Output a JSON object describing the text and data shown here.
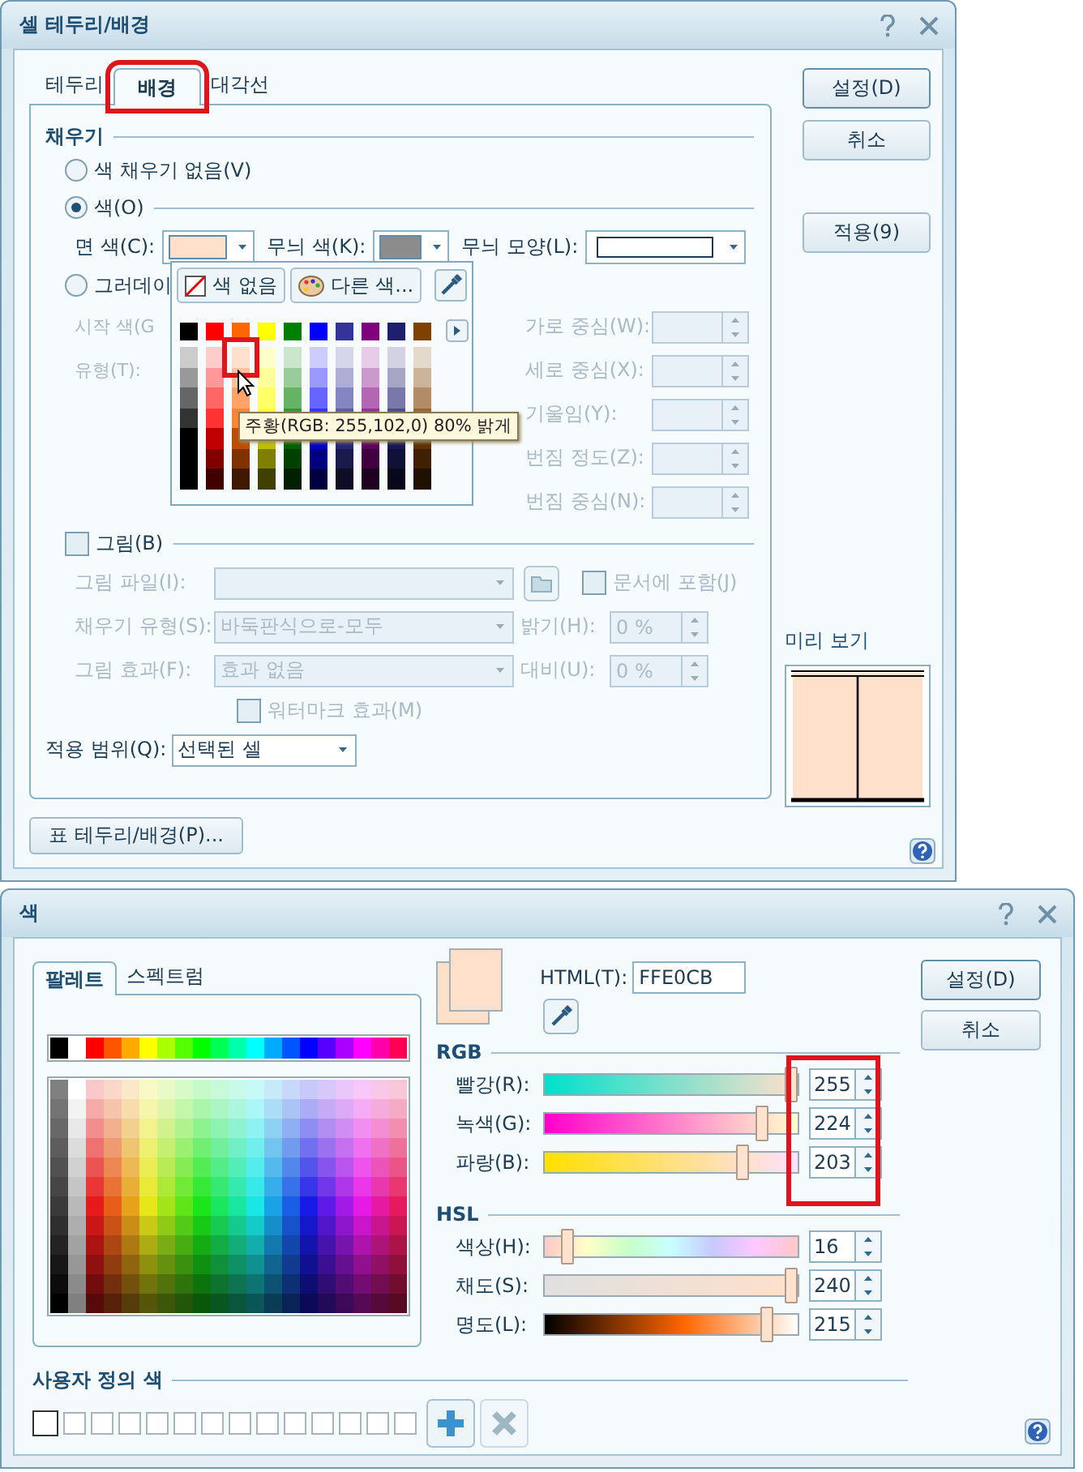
{
  "border_dialog": {
    "title": "셀 테두리/배경",
    "tabs": [
      {
        "label": "테두리",
        "selected": false,
        "highlighted": false
      },
      {
        "label": "배경",
        "selected": true,
        "highlighted": true
      },
      {
        "label": "대각선",
        "selected": false,
        "highlighted": false
      }
    ],
    "fill": {
      "heading": "채우기",
      "options": [
        {
          "label": "색 채우기 없음(V)",
          "selected": false
        },
        {
          "label": "색(O)",
          "selected": true
        }
      ],
      "swatches": [
        {
          "label": "면 색(C):",
          "color": "#ffe0cb"
        },
        {
          "label": "무늬 색(K):",
          "color": "#8c8c8c"
        }
      ],
      "pattern_shape_label": "무늬 모양(L):",
      "gradient": {
        "label": "그러데이",
        "selected": false,
        "start_color_label": "시작 색(G",
        "type_label": "유형(T):",
        "fields": [
          {
            "label": "가로 중심(W):"
          },
          {
            "label": "세로 중심(X):"
          },
          {
            "label": "기울임(Y):"
          },
          {
            "label": "번짐 정도(Z):"
          },
          {
            "label": "번짐 중심(N):"
          }
        ]
      }
    },
    "picture": {
      "label": "그림(B)",
      "checked": false,
      "file_label": "그림 파일(I):",
      "embed_label": "문서에 포함(J)",
      "embed_checked": false,
      "fill_type_label": "채우기 유형(S):",
      "fill_type": "바둑판식으로-모두",
      "brightness_label": "밝기(H):",
      "brightness": "0 %",
      "effect_label": "그림 효과(F):",
      "effect": "효과 없음",
      "contrast_label": "대비(U):",
      "contrast": "0 %",
      "watermark_label": "워터마크 효과(M)",
      "watermark_checked": false
    },
    "scope": {
      "label": "적용 범위(Q):",
      "value": "선택된 셀"
    },
    "table_button": "표 테두리/배경(P)...",
    "buttons": [
      {
        "label": "설정(D)",
        "default": true
      },
      {
        "label": "취소",
        "default": false
      },
      {
        "label": "적용(9)",
        "default": false
      }
    ],
    "preview": {
      "label": "미리 보기",
      "color": "#ffe0cb"
    },
    "color_popup": {
      "no_color": "색 없음",
      "more_colors": "다른 색...",
      "tooltip": "주황(RGB: 255,102,0) 80% 밝게",
      "colors": [
        {
          "color": "#000000",
          "tint_hovered": false
        },
        {
          "color": "#ff0000",
          "tint_hovered": false
        },
        {
          "color": "#ff6600",
          "tint_hovered": true
        },
        {
          "color": "#ffff00",
          "tint_hovered": false
        },
        {
          "color": "#008000",
          "tint_hovered": false
        },
        {
          "color": "#0000ff",
          "tint_hovered": false
        },
        {
          "color": "#333399",
          "tint_hovered": false
        },
        {
          "color": "#800080",
          "tint_hovered": false
        },
        {
          "color": "#1f1f70",
          "tint_hovered": false
        },
        {
          "color": "#7f4000",
          "tint_hovered": false
        }
      ]
    }
  },
  "color_dialog": {
    "title": "색",
    "tabs": [
      {
        "label": "팔레트",
        "selected": true
      },
      {
        "label": "스펙트럼",
        "selected": false
      }
    ],
    "html_label": "HTML(T):",
    "html_value": "FFE0CB",
    "rgb_heading": "RGB",
    "values_highlighted": true,
    "rgb": [
      {
        "label": "빨강(R):",
        "kind": "red",
        "level": 1,
        "value": "255"
      },
      {
        "label": "녹색(G):",
        "kind": "green",
        "level": 0.878,
        "value": "224"
      },
      {
        "label": "파랑(B):",
        "kind": "blue",
        "level": 0.796,
        "value": "203"
      }
    ],
    "hsl_heading": "HSL",
    "hsl": [
      {
        "label": "색상(H):",
        "kind": "hue",
        "level": 0.067,
        "value": "16"
      },
      {
        "label": "채도(S):",
        "kind": "saturation",
        "level": 1,
        "value": "240"
      },
      {
        "label": "명도(L):",
        "kind": "lightness",
        "level": 0.9,
        "value": "215"
      }
    ],
    "buttons": [
      {
        "label": "설정(D)",
        "default": true
      },
      {
        "label": "취소",
        "default": false
      }
    ],
    "custom_heading": "사용자 정의 색",
    "custom_slots": [
      {
        "selected": true
      },
      {
        "selected": false
      },
      {
        "selected": false
      },
      {
        "selected": false
      },
      {
        "selected": false
      },
      {
        "selected": false
      },
      {
        "selected": false
      },
      {
        "selected": false
      },
      {
        "selected": false
      },
      {
        "selected": false
      },
      {
        "selected": false
      },
      {
        "selected": false
      },
      {
        "selected": false
      },
      {
        "selected": false
      }
    ],
    "add_disabled": false,
    "remove_disabled": true
  }
}
